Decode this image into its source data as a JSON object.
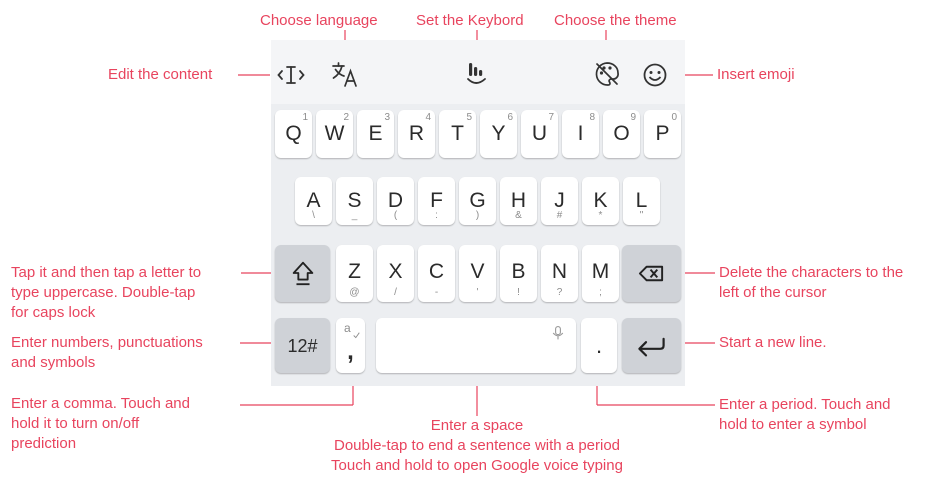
{
  "labels": {
    "choose_language": "Choose language",
    "set_keyboard": "Set the Keybord",
    "choose_theme": "Choose the theme",
    "edit_content": "Edit the content",
    "insert_emoji": "Insert emoji",
    "shift": [
      "Tap it and then tap a letter to",
      "type uppercase. Double-tap",
      "for caps lock"
    ],
    "delete": [
      "Delete the characters to the",
      "left of the cursor"
    ],
    "numbers": [
      "Enter numbers, punctuations",
      "and symbols"
    ],
    "new_line": "Start a new line.",
    "comma": [
      "Enter a comma. Touch and",
      "hold it to turn on/off",
      "prediction"
    ],
    "period": [
      "Enter a period. Touch and",
      "hold to enter a symbol"
    ],
    "space": [
      "Enter a space",
      "Double-tap to end a sentence with a period",
      "Touch and hold to open Google voice typing"
    ]
  },
  "keyboard": {
    "row1": [
      {
        "l": "Q",
        "h": "1"
      },
      {
        "l": "W",
        "h": "2"
      },
      {
        "l": "E",
        "h": "3"
      },
      {
        "l": "R",
        "h": "4"
      },
      {
        "l": "T",
        "h": "5"
      },
      {
        "l": "Y",
        "h": "6"
      },
      {
        "l": "U",
        "h": "7"
      },
      {
        "l": "I",
        "h": "8"
      },
      {
        "l": "O",
        "h": "9"
      },
      {
        "l": "P",
        "h": "0"
      }
    ],
    "row2": [
      {
        "l": "A",
        "s": "\\"
      },
      {
        "l": "S",
        "s": "_"
      },
      {
        "l": "D",
        "s": "("
      },
      {
        "l": "F",
        "s": ":"
      },
      {
        "l": "G",
        "s": ")"
      },
      {
        "l": "H",
        "s": "&"
      },
      {
        "l": "J",
        "s": "#"
      },
      {
        "l": "K",
        "s": "*"
      },
      {
        "l": "L",
        "s": "\""
      }
    ],
    "row3": [
      {
        "l": "Z",
        "s": "@"
      },
      {
        "l": "X",
        "s": "/"
      },
      {
        "l": "C",
        "s": "-"
      },
      {
        "l": "V",
        "s": "'"
      },
      {
        "l": "B",
        "s": "!"
      },
      {
        "l": "N",
        "s": "?"
      },
      {
        "l": "M",
        "s": ";"
      }
    ],
    "num_key": "12#",
    "comma_key": ",",
    "comma_hint": "a",
    "period_key": "."
  },
  "colors": {
    "annotation": "#e8445e",
    "keyboard_bg": "#eceef1",
    "key_bg": "#ffffff",
    "func_key_bg": "#cfd2d7"
  },
  "icons": {
    "edit": "text-cursor-icon",
    "language": "translate-icon",
    "keyboard_settings": "hand-touch-icon",
    "theme": "palette-off-icon",
    "emoji": "smiley-icon",
    "shift": "shift-arrow-icon",
    "backspace": "backspace-icon",
    "mic": "mic-icon",
    "enter": "enter-arrow-icon"
  }
}
